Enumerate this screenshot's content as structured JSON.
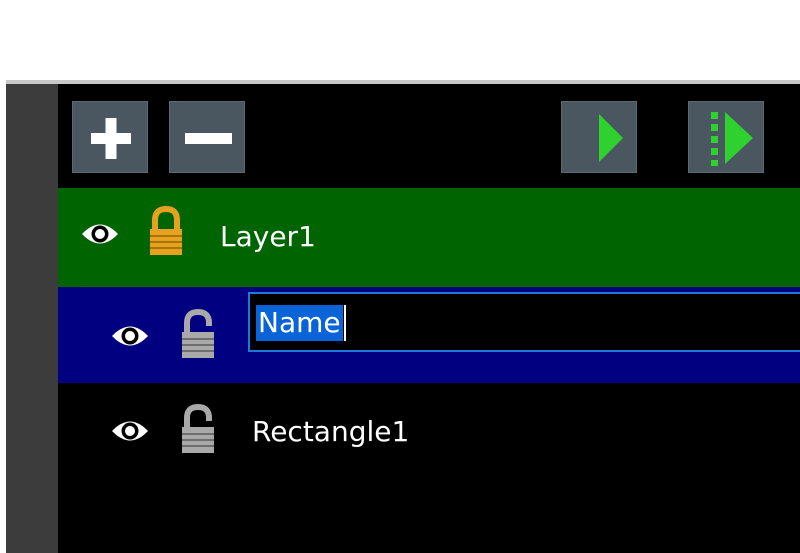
{
  "toolbar": {
    "add_icon": "plus-icon",
    "remove_icon": "minus-icon",
    "play_icon": "play-icon",
    "play_frames_icon": "play-frames-icon",
    "button_bg": "#4a5760",
    "play_color": "#2fd12f"
  },
  "layers": {
    "layer1": {
      "label": "Layer1",
      "visible": true,
      "locked": true,
      "bg": "#006400"
    },
    "editing": {
      "value": "Name",
      "visible": true,
      "locked": false,
      "bg": "#000080"
    },
    "rect": {
      "label": "Rectangle1",
      "visible": true,
      "locked": false
    }
  },
  "colors": {
    "lock_locked": "#e6a21e",
    "lock_unlocked": "#a9a9a9",
    "selection": "#0a64d8",
    "focus_border": "#1e78d7"
  }
}
